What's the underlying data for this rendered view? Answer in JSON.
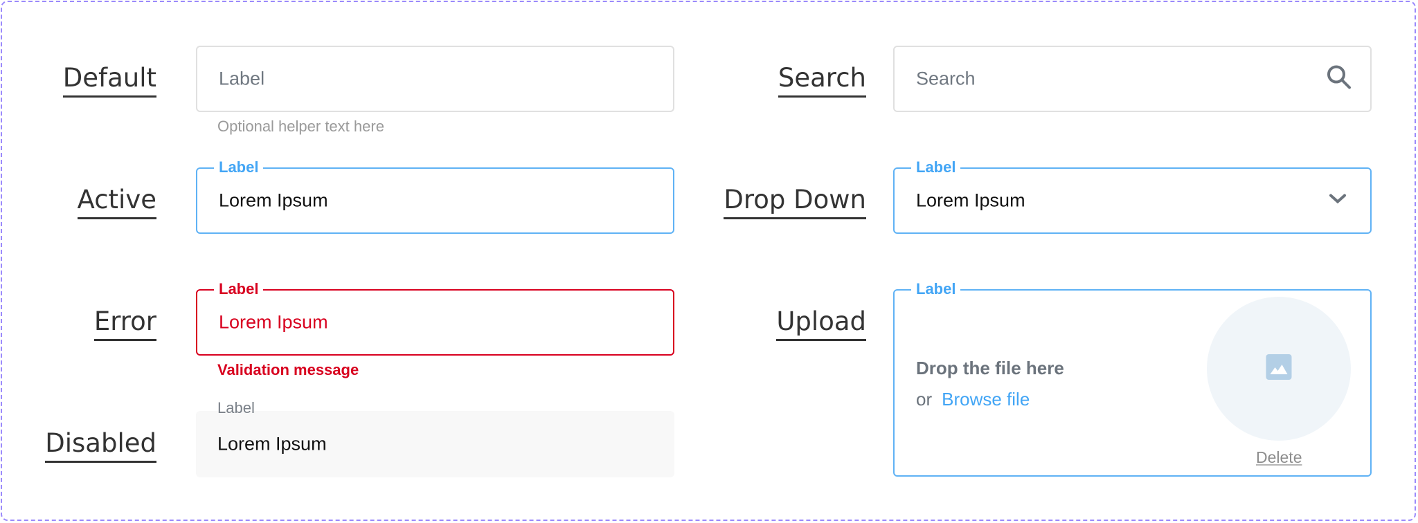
{
  "rows_left": {
    "default": {
      "row_label": "Default",
      "placeholder": "Label",
      "helper": "Optional helper text here"
    },
    "active": {
      "row_label": "Active",
      "legend": "Label",
      "value": "Lorem Ipsum"
    },
    "error": {
      "row_label": "Error",
      "legend": "Label",
      "value": "Lorem Ipsum",
      "validation": "Validation message"
    },
    "disabled": {
      "row_label": "Disabled",
      "legend": "Label",
      "value": "Lorem Ipsum"
    }
  },
  "rows_right": {
    "search": {
      "row_label": "Search",
      "placeholder": "Search",
      "icon": "search-icon"
    },
    "dropdown": {
      "row_label": "Drop Down",
      "legend": "Label",
      "selected": "Lorem Ipsum",
      "icon": "chevron-down-icon"
    },
    "upload": {
      "row_label": "Upload",
      "legend": "Label",
      "drop_text": "Drop the file here",
      "or_text": "or",
      "browse_label": "Browse file",
      "delete_label": "Delete",
      "icon": "image-icon"
    }
  },
  "colors": {
    "frame_dash": "#9b8afb",
    "active_blue": "#42a5f5",
    "error_red": "#d8001f",
    "default_border": "#e0e0e0",
    "disabled_bg": "#f8f8f8",
    "icon_gray": "#6b737c"
  }
}
